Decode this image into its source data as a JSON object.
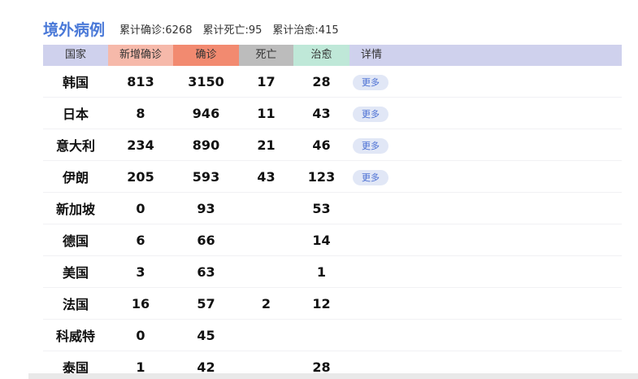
{
  "header": {
    "title": "境外病例",
    "stats": [
      "累计确诊:6268",
      "累计死亡:95",
      "累计治愈:415"
    ]
  },
  "table": {
    "headers": [
      "国家",
      "新增确诊",
      "确诊",
      "死亡",
      "治愈",
      "详情"
    ],
    "rows": [
      {
        "country": "韩国",
        "new": "813",
        "confirmed": "3150",
        "dead": "17",
        "cured": "28",
        "more": "更多"
      },
      {
        "country": "日本",
        "new": "8",
        "confirmed": "946",
        "dead": "11",
        "cured": "43",
        "more": "更多"
      },
      {
        "country": "意大利",
        "new": "234",
        "confirmed": "890",
        "dead": "21",
        "cured": "46",
        "more": "更多"
      },
      {
        "country": "伊朗",
        "new": "205",
        "confirmed": "593",
        "dead": "43",
        "cured": "123",
        "more": "更多"
      },
      {
        "country": "新加坡",
        "new": "0",
        "confirmed": "93",
        "dead": "",
        "cured": "53",
        "more": ""
      },
      {
        "country": "德国",
        "new": "6",
        "confirmed": "66",
        "dead": "",
        "cured": "14",
        "more": ""
      },
      {
        "country": "美国",
        "new": "3",
        "confirmed": "63",
        "dead": "",
        "cured": "1",
        "more": ""
      },
      {
        "country": "法国",
        "new": "16",
        "confirmed": "57",
        "dead": "2",
        "cured": "12",
        "more": ""
      },
      {
        "country": "科威特",
        "new": "0",
        "confirmed": "45",
        "dead": "",
        "cured": "",
        "more": ""
      },
      {
        "country": "泰国",
        "new": "1",
        "confirmed": "42",
        "dead": "",
        "cured": "28",
        "more": ""
      }
    ]
  },
  "colors": {
    "title": "#4a79d8",
    "header_bg": "#cfd1ed",
    "new_col": "#f6b9aa",
    "confirmed_col": "#f28a70",
    "dead_col": "#bcbcbc",
    "cured_col": "#bfe8d8",
    "more_btn_bg": "#e1e7f6",
    "more_btn_text": "#4a6fd3"
  }
}
